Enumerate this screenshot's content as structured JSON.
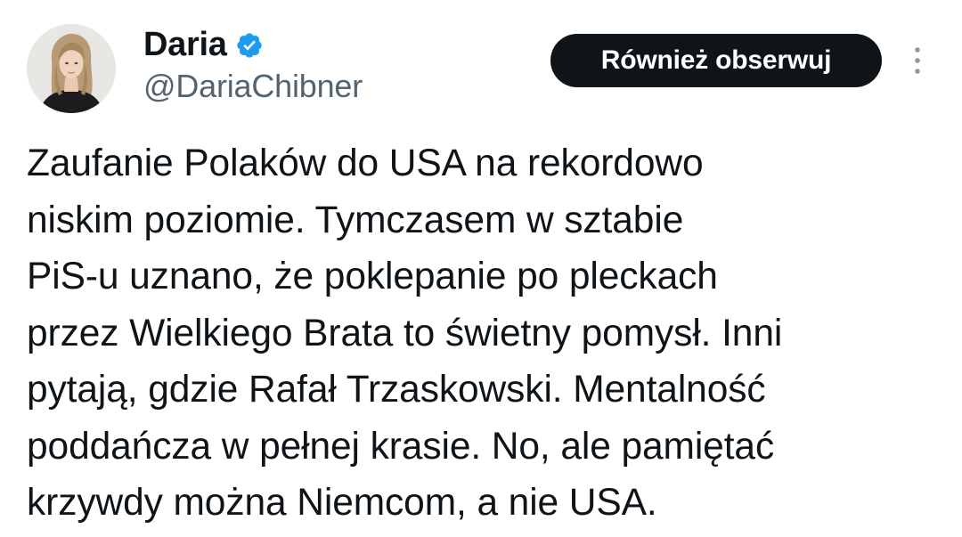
{
  "author": {
    "display_name": "Daria",
    "handle": "@DariaChibner",
    "verified": true,
    "avatar": "profile-photo"
  },
  "actions": {
    "follow_label": "Również obserwuj",
    "more_icon": "more-vertical-icon"
  },
  "tweet": {
    "lines": [
      "Zaufanie Polaków do USA na rekordowo",
      "niskim poziomie. Tymczasem w sztabie",
      "PiS-u uznano, że poklepanie po pleckach",
      "przez Wielkiego Brata to świetny pomysł. Inni",
      "pytają, gdzie Rafał Trzaskowski. Mentalność",
      "poddańcza w pełnej krasie. No, ale pamiętać",
      "krzywdy można Niemcom, a nie USA."
    ]
  },
  "colors": {
    "text": "#0f1419",
    "secondary": "#536471",
    "verified": "#1d9bf0",
    "button_bg": "#0f1419",
    "button_text": "#ffffff"
  }
}
